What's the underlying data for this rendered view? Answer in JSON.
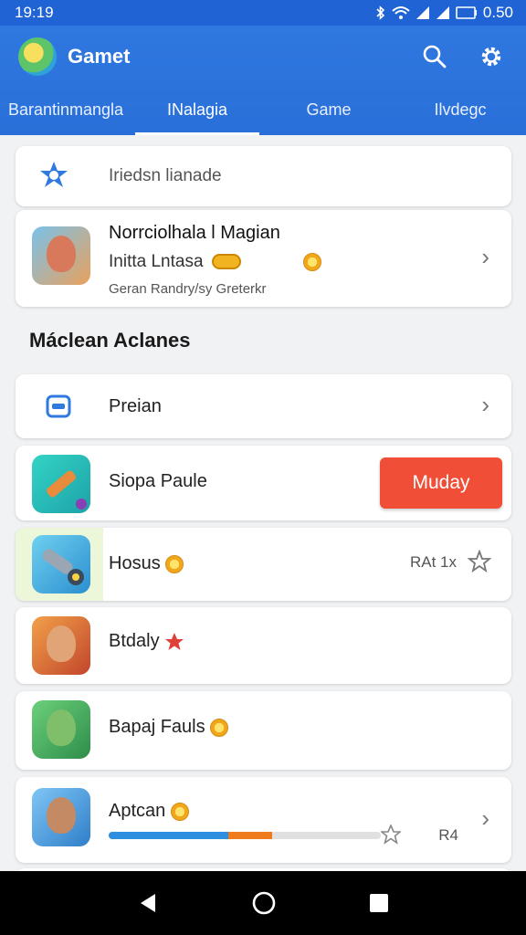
{
  "status_bar": {
    "time": "19:19",
    "battery": "0.50"
  },
  "app": {
    "title": "Gamet"
  },
  "tabs": [
    {
      "label": "Barantinmangla"
    },
    {
      "label": "INalagia"
    },
    {
      "label": "Game"
    },
    {
      "label": "Ilvdegc"
    }
  ],
  "search": {
    "placeholder": "Iriedsn lianade"
  },
  "featured": {
    "title": "Norrciolhala l Magian",
    "subtitle": "Initta Lntasa",
    "meta": "Geran Randry/sy Greterkr"
  },
  "section": {
    "title": "Máclean Aclanes"
  },
  "rows": [
    {
      "label": "Preian"
    },
    {
      "label": "Siopa Paule",
      "button": "Muday"
    },
    {
      "label": "Hosus",
      "rating_text": "RAt 1x"
    },
    {
      "label": "Btdaly"
    },
    {
      "label": "Bapaj Fauls"
    },
    {
      "label": "Aptcan",
      "count": "R4",
      "progress_blue": 0.44,
      "progress_orange": 0.16
    }
  ],
  "colors": {
    "accent": "#2a6fd9",
    "button": "#f04e37"
  }
}
